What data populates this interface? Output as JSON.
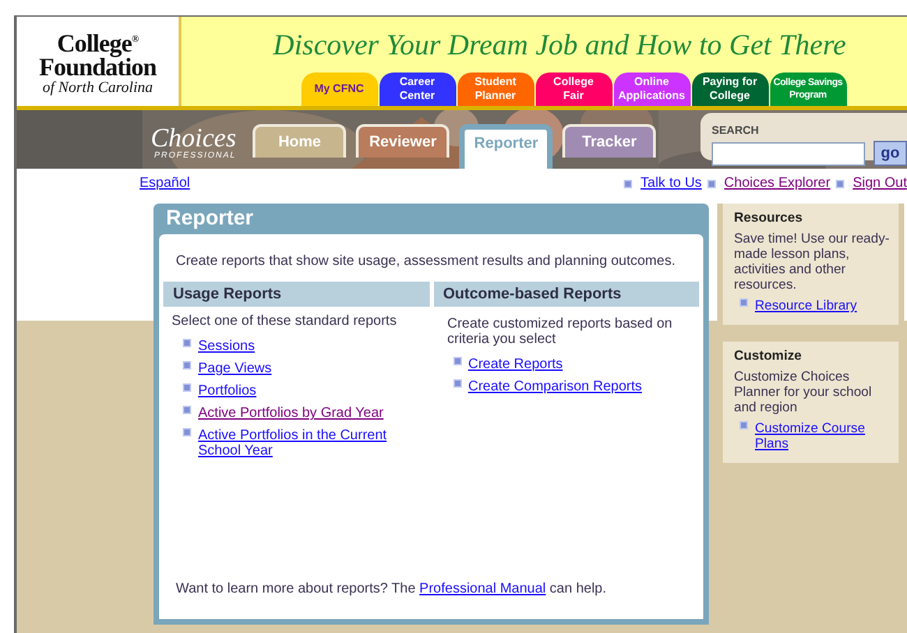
{
  "header": {
    "logo": {
      "line1": "College",
      "mark": "®",
      "line2": "Foundation",
      "line3": "of North Carolina"
    },
    "slogan": "Discover Your Dream Job and How to Get There",
    "tabs": [
      {
        "label": "My CFNC",
        "color": "#ffcc00"
      },
      {
        "label": "Career Center",
        "color": "#3333ff"
      },
      {
        "label": "Student Planner",
        "color": "#ff6600"
      },
      {
        "label": "College Fair",
        "color": "#ff0066"
      },
      {
        "label": "Online Applications",
        "color": "#cc33ff"
      },
      {
        "label": "Paying for College",
        "color": "#006633"
      },
      {
        "label": "College Savings Program",
        "color": "#009933",
        "kind": "small"
      }
    ]
  },
  "nav": {
    "logo": {
      "title": "Choices",
      "subtitle": "PROFESSIONAL"
    },
    "tabs": [
      {
        "label": "Home",
        "color": "#c7b58e",
        "selected": false
      },
      {
        "label": "Reviewer",
        "color": "#b97c5c",
        "selected": false
      },
      {
        "label": "Reporter",
        "color": "#7ba7bd",
        "selected": true
      },
      {
        "label": "Tracker",
        "color": "#a08bb3",
        "selected": false
      }
    ],
    "search": {
      "label": "SEARCH",
      "button": "go"
    }
  },
  "links": {
    "language": {
      "label": "Español",
      "visited": false
    },
    "items": [
      {
        "label": "Talk to Us",
        "visited": false
      },
      {
        "label": "Choices Explorer",
        "visited": true
      },
      {
        "label": "Sign Out",
        "visited": true
      }
    ]
  },
  "panel": {
    "title": "Reporter",
    "intro": "Create reports that show site usage, assessment results and planning outcomes.",
    "columns": [
      {
        "heading": "Usage Reports",
        "text": "Select one of these standard reports",
        "links": [
          {
            "label": "Sessions",
            "visited": false
          },
          {
            "label": "Page Views",
            "visited": false
          },
          {
            "label": "Portfolios",
            "visited": false
          },
          {
            "label": "Active Portfolios by Grad Year",
            "visited": true
          },
          {
            "label": "Active Portfolios in the Current School Year",
            "visited": false
          }
        ]
      },
      {
        "heading": "Outcome-based Reports",
        "text": "Create customized reports based on criteria you select",
        "links": [
          {
            "label": "Create Reports",
            "visited": false
          },
          {
            "label": "Create Comparison Reports",
            "visited": false
          }
        ]
      }
    ],
    "footer": {
      "before": "Want to learn more about reports? The",
      "link": "Professional Manual",
      "after": "can help."
    }
  },
  "sidebar": [
    {
      "title": "Resources",
      "text": "Save time! Use our ready-made lesson plans, activities and other resources.",
      "link": "Resource Library"
    },
    {
      "title": "Customize",
      "text": "Customize Choices Planner for your school and region",
      "link": "Customize Course Plans"
    }
  ]
}
